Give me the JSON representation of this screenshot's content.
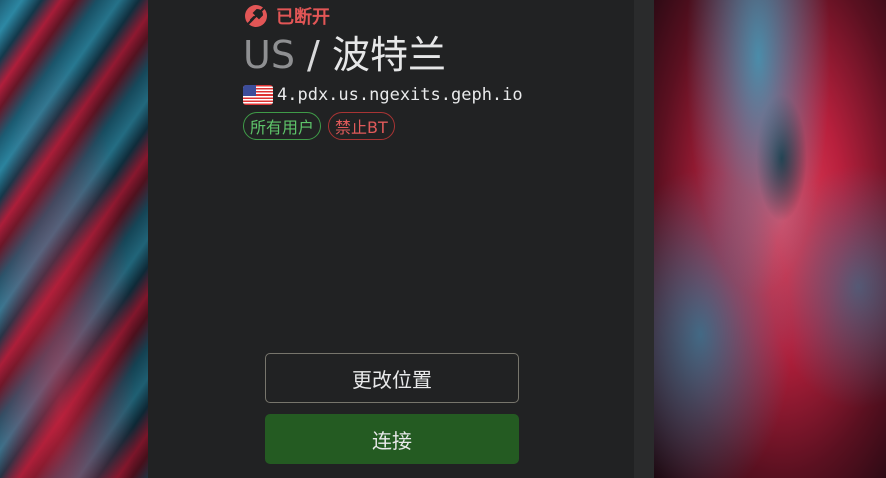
{
  "status": {
    "icon": "disconnected-icon",
    "label": "已断开",
    "color": "#e25656"
  },
  "location": {
    "country": "US",
    "separator": "/",
    "city": "波特兰"
  },
  "server": {
    "flag_icon": "us-flag-icon",
    "hostname": "4.pdx.us.ngexits.geph.io"
  },
  "tags": [
    {
      "label": "所有用户",
      "color": "#5ec46a"
    },
    {
      "label": "禁止BT",
      "color": "#e05a5a"
    }
  ],
  "buttons": {
    "change_location": "更改位置",
    "connect": "连接"
  },
  "colors": {
    "panel_bg": "#212223",
    "connect_bg": "#245b22"
  }
}
